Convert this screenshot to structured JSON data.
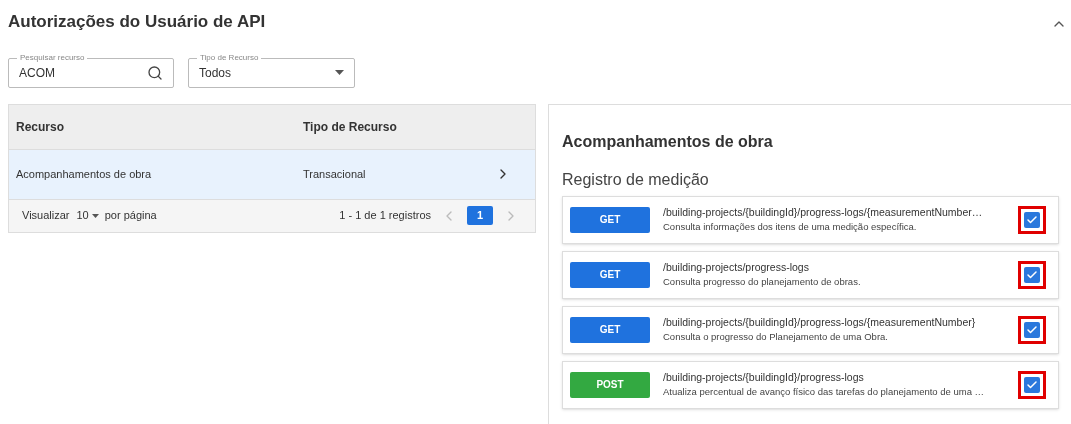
{
  "page": {
    "title": "Autorizações do Usuário de API",
    "collapsed": false
  },
  "filters": {
    "search": {
      "label": "Pesquisar recurso",
      "value": "ACOM"
    },
    "type": {
      "label": "Tipo de Recurso",
      "value": "Todos"
    }
  },
  "table": {
    "columns": [
      "Recurso",
      "Tipo de Recurso"
    ],
    "rows": [
      {
        "resource": "Acompanhamentos de obra",
        "type": "Transacional",
        "selected": true
      }
    ],
    "footer": {
      "show_label": "Visualizar",
      "page_size": "10",
      "per_page": "por página",
      "range": "1 - 1 de 1 registros",
      "pages": [
        {
          "label": "1",
          "selected": true
        }
      ]
    }
  },
  "detail": {
    "title": "Acompanhamentos de obra",
    "section": "Registro de medição",
    "endpoints": [
      {
        "kind": "get",
        "method": "GET",
        "path": "/building-projects/{buildingId}/progress-logs/{measurementNumber…",
        "description": "Consulta informações dos itens de uma medição específica.",
        "checked": true,
        "highlighted": true
      },
      {
        "kind": "get",
        "method": "GET",
        "path": "/building-projects/progress-logs",
        "description": "Consulta progresso do planejamento de obras.",
        "checked": true,
        "highlighted": true
      },
      {
        "kind": "get",
        "method": "GET",
        "path": "/building-projects/{buildingId}/progress-logs/{measurementNumber}",
        "description": "Consulta o progresso do Planejamento de uma Obra.",
        "checked": true,
        "highlighted": true
      },
      {
        "kind": "post",
        "method": "POST",
        "path": "/building-projects/{buildingId}/progress-logs",
        "description": "Atualiza percentual de avanço físico das tarefas do planejamento de uma …",
        "checked": true,
        "highlighted": true
      }
    ]
  }
}
